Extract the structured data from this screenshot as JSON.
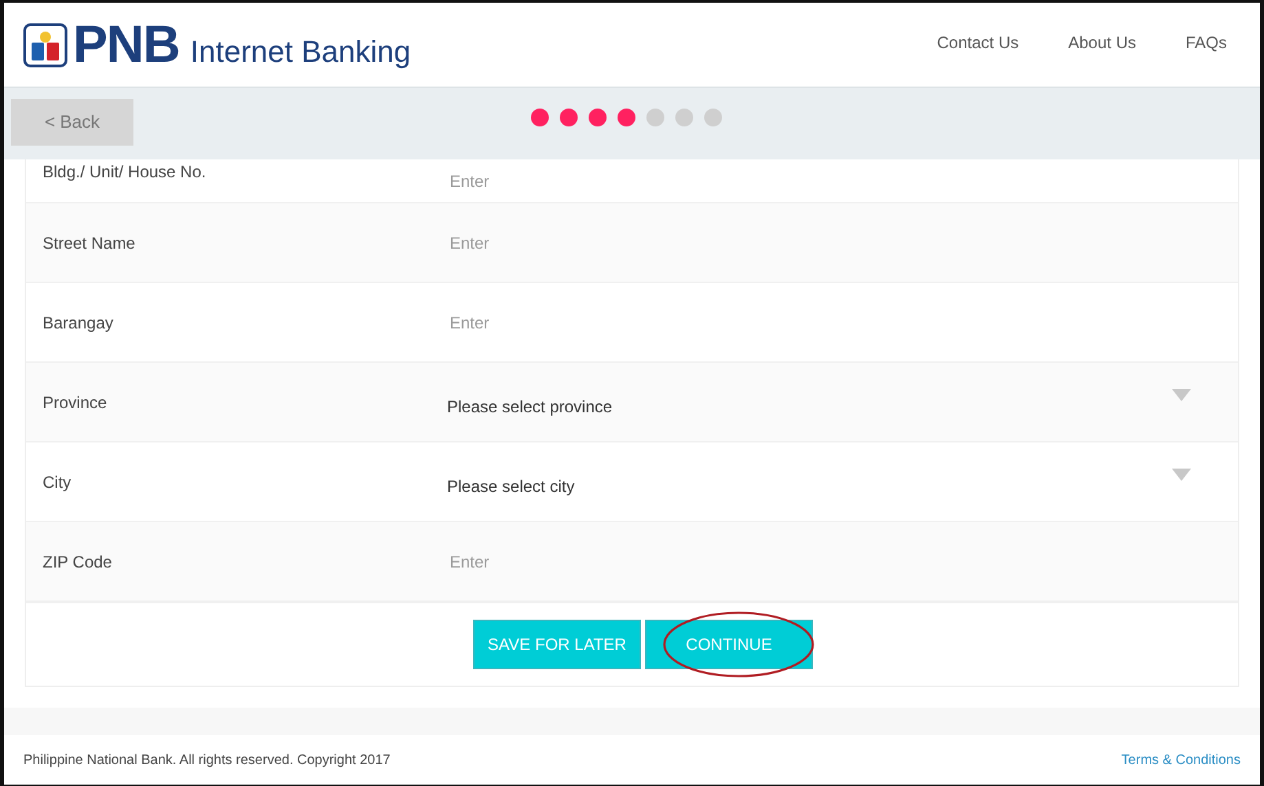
{
  "header": {
    "brand": "PNB",
    "product": "Internet Banking",
    "nav": [
      {
        "label": "Contact Us"
      },
      {
        "label": "About Us"
      },
      {
        "label": "FAQs"
      }
    ]
  },
  "back_button": "< Back",
  "progress": {
    "steps": [
      {
        "done": true
      },
      {
        "done": true
      },
      {
        "done": true
      },
      {
        "done": true
      },
      {
        "done": false
      },
      {
        "done": false
      },
      {
        "done": false
      }
    ]
  },
  "form": {
    "rows": [
      {
        "kind": "input",
        "label": "Bldg./ Unit/ House No.",
        "placeholder": "Enter"
      },
      {
        "kind": "input",
        "label": "Street Name",
        "placeholder": "Enter"
      },
      {
        "kind": "input",
        "label": "Barangay",
        "placeholder": "Enter"
      },
      {
        "kind": "select",
        "label": "Province",
        "value": "Please select province"
      },
      {
        "kind": "select",
        "label": "City",
        "value": "Please select city"
      },
      {
        "kind": "input",
        "label": "ZIP Code",
        "placeholder": "Enter"
      }
    ]
  },
  "buttons": [
    {
      "label": "SAVE FOR LATER",
      "circled": false
    },
    {
      "label": "CONTINUE",
      "circled": true
    }
  ],
  "footer": {
    "copyright": "Philippine National Bank. All rights reserved. Copyright 2017",
    "link": "Terms & Conditions"
  }
}
